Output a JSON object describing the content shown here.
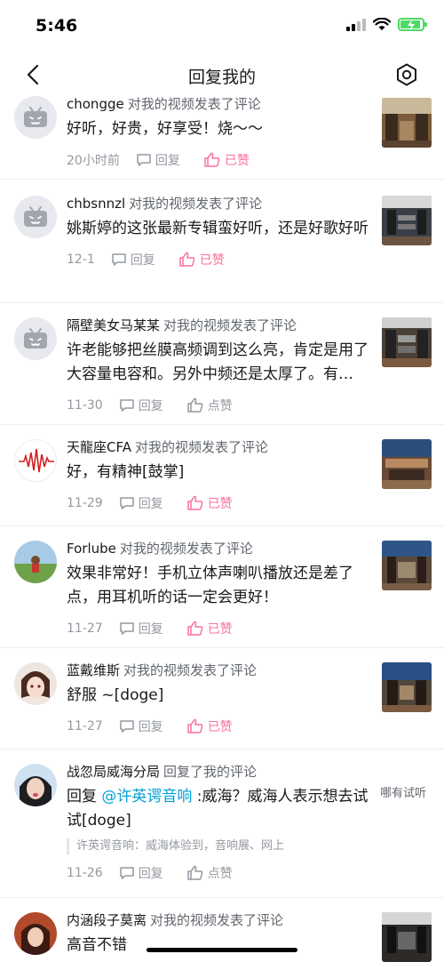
{
  "status": {
    "time": "5:46"
  },
  "nav": {
    "title": "回复我的"
  },
  "labels": {
    "reply": "回复",
    "liked": "已赞",
    "like": "点赞"
  },
  "items": [
    {
      "user": "chongge",
      "action": "对我的视频发表了评论",
      "text": "好听，好贵，好享受！烧～～",
      "time": "20小时前",
      "like": "已赞"
    },
    {
      "user": "chbsnnzl",
      "action": "对我的视频发表了评论",
      "text": "姚斯婷的这张最新专辑蛮好听，还是好歌好听",
      "time": "12-1",
      "like": "已赞"
    },
    {
      "user": "隔壁美女马某某",
      "action": "对我的视频发表了评论",
      "text": "许老能够把丝膜高频调到这么亮，肯定是用了大容量电容和。另外中频还是太厚了。有…",
      "time": "11-30",
      "like": "点赞"
    },
    {
      "user": "天龍座CFA",
      "action": "对我的视频发表了评论",
      "text": "好，有精神[鼓掌]",
      "time": "11-29",
      "like": "已赞"
    },
    {
      "user": "Forlube",
      "action": "对我的视频发表了评论",
      "text": "效果非常好！手机立体声喇叭播放还是差了点，用耳机听的话一定会更好！",
      "time": "11-27",
      "like": "已赞"
    },
    {
      "user": "蓝戴维斯",
      "action": "对我的视频发表了评论",
      "text": "舒服 ~[doge]",
      "time": "11-27",
      "like": "已赞"
    },
    {
      "user": "战忽局威海分局",
      "action": "回复了我的评论",
      "text_prefix": "回复 ",
      "mention": "@许英谔音响",
      "text_suffix": " :威海？威海人表示想去试试[doge]",
      "quote": "许英谔音响：威海体验到，音响展、网上",
      "side": "哪有试听",
      "time": "11-26",
      "like": "点赞"
    },
    {
      "user": "内涵段子莫离",
      "action": "对我的视频发表了评论",
      "text": "高音不错"
    }
  ],
  "colors": {
    "accent": "#fb7299",
    "link": "#00a1d6",
    "muted": "#9499a0"
  }
}
